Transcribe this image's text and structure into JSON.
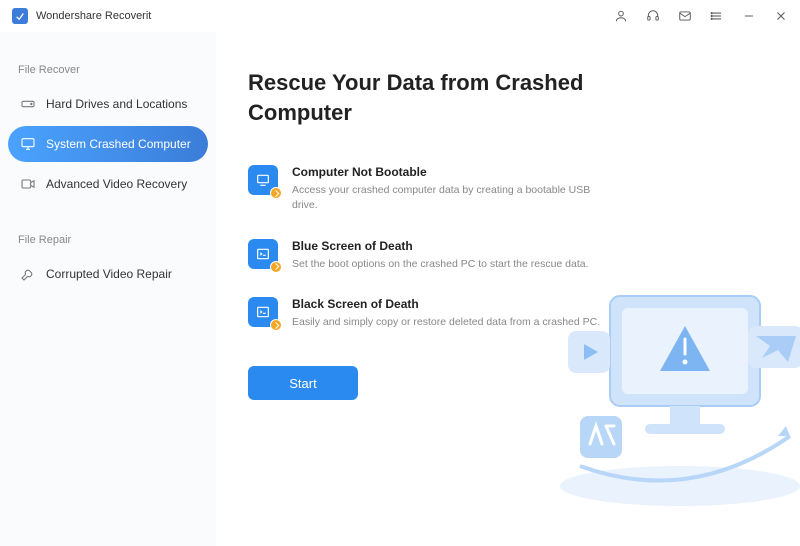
{
  "app": {
    "title": "Wondershare Recoverit"
  },
  "sidebar": {
    "section1_label": "File Recover",
    "items1": [
      {
        "label": "Hard Drives and Locations"
      },
      {
        "label": "System Crashed Computer"
      },
      {
        "label": "Advanced Video Recovery"
      }
    ],
    "section2_label": "File Repair",
    "items2": [
      {
        "label": "Corrupted Video Repair"
      }
    ]
  },
  "main": {
    "title": "Rescue Your Data from Crashed Computer",
    "features": [
      {
        "title": "Computer Not Bootable",
        "desc": "Access your crashed computer data by creating a bootable USB drive."
      },
      {
        "title": "Blue Screen of Death",
        "desc": "Set the boot options on the crashed PC to start the rescue data."
      },
      {
        "title": "Black Screen of Death",
        "desc": "Easily and simply copy or restore deleted data from a crashed PC."
      }
    ],
    "start_label": "Start"
  }
}
